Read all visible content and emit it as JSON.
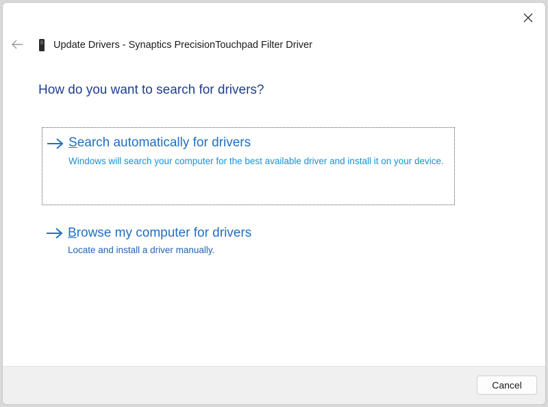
{
  "dialog": {
    "title": "Update Drivers - Synaptics PrecisionTouchpad Filter Driver",
    "question": "How do you want to search for drivers?"
  },
  "options": [
    {
      "title_first": "S",
      "title_rest": "earch automatically for drivers",
      "description": "Windows will search your computer for the best available driver and install it on your device."
    },
    {
      "title_first": "B",
      "title_rest": "rowse my computer for drivers",
      "description": "Locate and install a driver manually."
    }
  ],
  "footer": {
    "cancel_label": "Cancel"
  },
  "icons": {
    "close": "close-icon",
    "back": "back-arrow-icon",
    "device": "device-icon",
    "option_arrow": "arrow-right-icon"
  },
  "colors": {
    "question": "#1e3f8a",
    "option_title": "#1f6fc5",
    "option_desc": "#1a8fd6"
  }
}
